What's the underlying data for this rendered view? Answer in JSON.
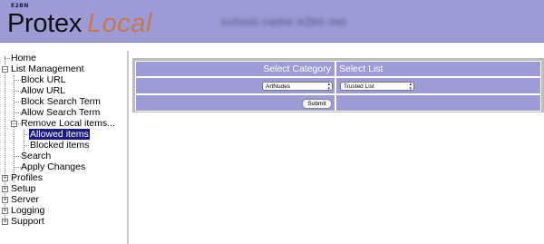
{
  "header": {
    "brand_small": "E2BN",
    "brand_name": "Protex",
    "brand_accent": "Local",
    "blurred_text": "school-name.e2bn.net"
  },
  "sidebar": {
    "items": [
      {
        "label": "Home"
      },
      {
        "label": "List Management"
      },
      {
        "label": "Block URL"
      },
      {
        "label": "Allow URL"
      },
      {
        "label": "Block Search Term"
      },
      {
        "label": "Allow Search Term"
      },
      {
        "label": "Remove Local items..."
      },
      {
        "label": "Allowed items"
      },
      {
        "label": "Blocked items"
      },
      {
        "label": "Search"
      },
      {
        "label": "Apply Changes"
      },
      {
        "label": "Profiles"
      },
      {
        "label": "Setup"
      },
      {
        "label": "Server"
      },
      {
        "label": "Logging"
      },
      {
        "label": "Support"
      }
    ]
  },
  "form": {
    "category_heading": "Select Category",
    "list_heading": "Select List",
    "category_value": "ArtNudes",
    "list_value": "Trusted List",
    "submit_label": "Submit"
  },
  "colors": {
    "header_bg": "#9c9bd5",
    "panel_bg": "#9c9bd5",
    "selected_bg": "#1a1a80",
    "brand_accent": "#c87850"
  }
}
